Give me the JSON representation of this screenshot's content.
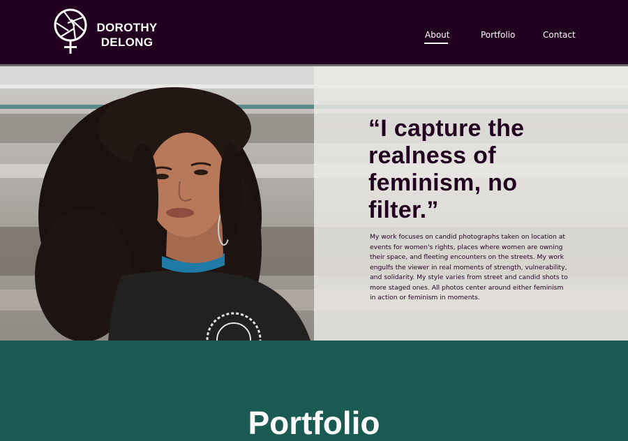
{
  "header": {
    "brand_line1": "DOROTHY",
    "brand_line2": "DELONG",
    "logo_icon": "camera-shutter-female-symbol-icon",
    "nav": {
      "about": "About",
      "portfolio": "Portfolio",
      "contact": "Contact",
      "active": "About"
    },
    "background": "#22001f"
  },
  "hero": {
    "quote": "“I capture the realness of feminism, no filter.”",
    "blurb": "My work focuses on candid photographs taken on location at events for women's rights, places where women are owning their space, and fleeting encounters on the streets. My work engulfs the viewer in real moments of strength, vulnerability, and solidarity. My style varies from street and candid shots to more staged ones. All photos center around either feminism in action or feminism in moments.",
    "image": "portrait-of-woman-with-curly-hair"
  },
  "portfolio": {
    "title": "Portfolio",
    "background": "#1a5a52"
  }
}
